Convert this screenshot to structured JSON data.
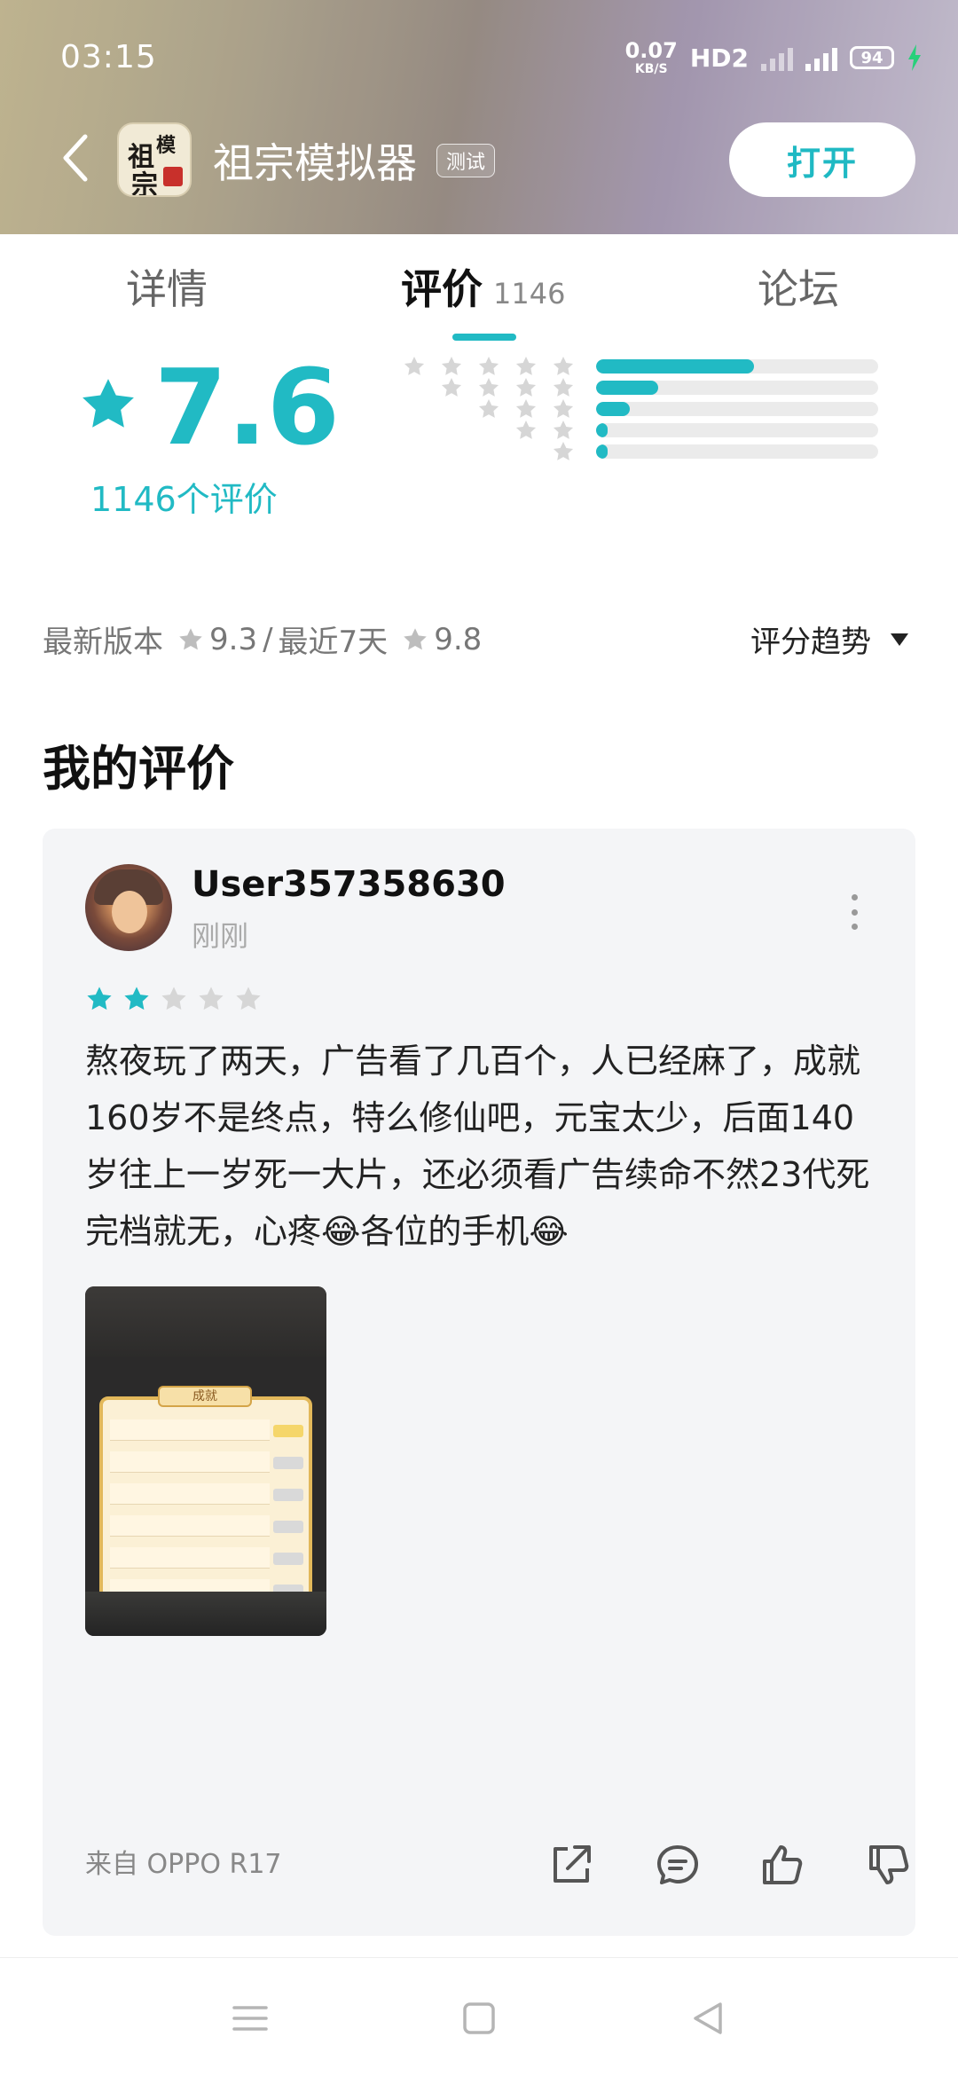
{
  "status_bar": {
    "time": "03:15",
    "net_speed": "0.07",
    "net_unit": "KB/S",
    "hd_label": "HD2",
    "battery": "94"
  },
  "header": {
    "app_name": "祖宗模拟器",
    "badge": "测试",
    "open_button": "打开",
    "icon_text": "祖宗模拟"
  },
  "tabs": {
    "detail": "详情",
    "review": "评价",
    "review_count": "1146",
    "forum": "论坛"
  },
  "rating": {
    "score": "7.6",
    "count_label": "1146个评价",
    "distribution": [
      {
        "stars": 5,
        "fraction": 0.56
      },
      {
        "stars": 4,
        "fraction": 0.22
      },
      {
        "stars": 3,
        "fraction": 0.12
      },
      {
        "stars": 2,
        "fraction": 0.04
      },
      {
        "stars": 1,
        "fraction": 0.04
      }
    ]
  },
  "version": {
    "latest_label": "最新版本",
    "latest_score": "9.3",
    "separator": "/",
    "recent_label": "最近7天",
    "recent_score": "9.8",
    "trend_label": "评分趋势"
  },
  "my_review": {
    "section_title": "我的评价",
    "username": "User357358630",
    "time": "刚刚",
    "stars": 2,
    "text": "熬夜玩了两天，广告看了几百个，人已经麻了，成就160岁不是终点，特么修仙吧，元宝太少，后面140岁往上一岁死一大片，还必须看广告续命不然23代死完档就无，心疼😂各位的手机😂",
    "screenshot_title": "成就",
    "device": "来自 OPPO R17"
  },
  "colors": {
    "accent": "#21bac4",
    "star_empty": "#d6d6d6"
  },
  "icons": {
    "back": "back-arrow-icon",
    "share": "share-icon",
    "comment": "comment-icon",
    "like": "thumbs-up-icon",
    "dislike": "thumbs-down-icon",
    "more": "more-vertical-icon"
  }
}
